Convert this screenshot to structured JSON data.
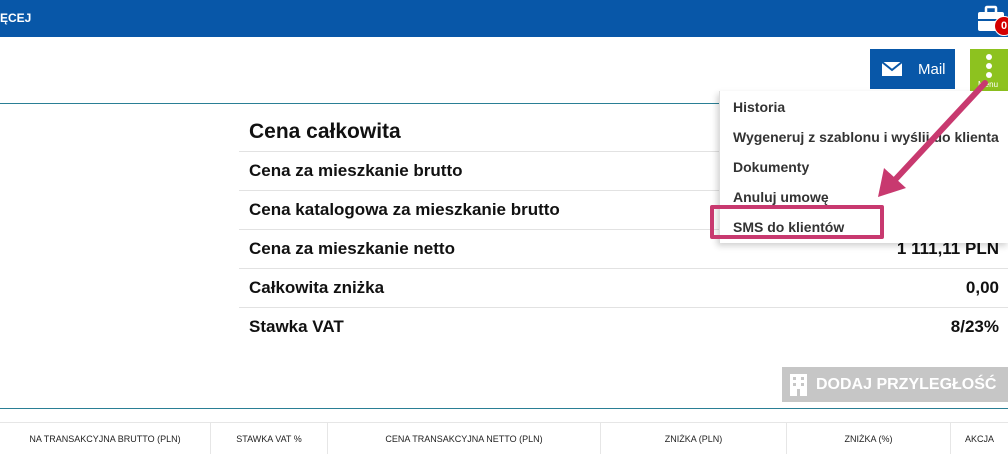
{
  "topbar": {
    "title_partial": "ĘCEJ",
    "badge_count": "0",
    "bar_color": "#0857a8",
    "icon": "briefcase-icon"
  },
  "actions": {
    "mail_label": "Mail",
    "mail_icon": "envelope-icon",
    "mail_color": "#0857a8",
    "menu_label": "Menu",
    "menu_icon": "vertical-dots-icon",
    "menu_color": "#8dc21f"
  },
  "summary": {
    "title": "Cena całkowita",
    "rows": [
      {
        "label": "Cena za mieszkanie brutto",
        "value": ""
      },
      {
        "label": "Cena katalogowa za mieszkanie brutto",
        "value": ""
      },
      {
        "label": "Cena za mieszkanie netto",
        "value": "1 111,11 PLN"
      },
      {
        "label": "Całkowita zniżka",
        "value": "0,00"
      },
      {
        "label": "Stawka VAT",
        "value": "8/23%"
      }
    ]
  },
  "menu_items": [
    {
      "label": "Historia"
    },
    {
      "label": "Wygeneruj z szablonu i wyślij do klienta"
    },
    {
      "label": "Dokumenty"
    },
    {
      "label": "Anuluj umowę"
    },
    {
      "label": "SMS do klientów"
    }
  ],
  "annotation": {
    "highlight_color": "#c8396f"
  },
  "add_button": {
    "label": "DODAJ PRZYLEGŁOŚĆ",
    "icon": "building-icon"
  },
  "table": {
    "columns": [
      "NA TRANSAKCYJNA BRUTTO (PLN)",
      "STAWKA VAT %",
      "CENA TRANSAKCYJNA NETTO (PLN)",
      "ZNIŻKA (PLN)",
      "ZNIŻKA (%)",
      "AKCJA"
    ]
  }
}
